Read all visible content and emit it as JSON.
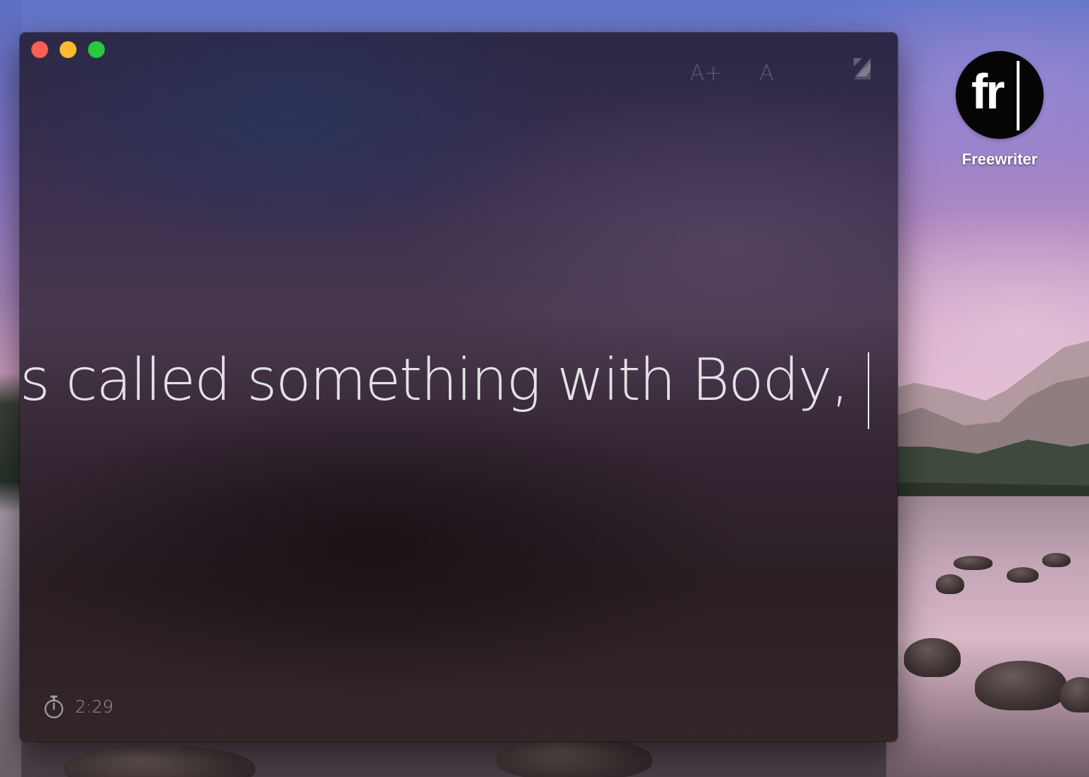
{
  "window": {
    "controls": {
      "close": "close",
      "minimize": "minimize",
      "zoom": "zoom"
    },
    "toolbar": {
      "font_larger_label": "A+",
      "font_reset_label": "A",
      "fullscreen_icon": "fullscreen-toggle-icon"
    },
    "editor": {
      "text": "k is called something with Body,"
    },
    "timer": {
      "icon": "stopwatch-icon",
      "value": "2:29"
    }
  },
  "desktop": {
    "icon": {
      "glyph": "fr",
      "label": "Freewriter"
    }
  },
  "colors": {
    "close": "#fe5f57",
    "minimize": "#febc2e",
    "zoom": "#28c840",
    "text": "#f3eef2",
    "icon_background": "#050505"
  }
}
